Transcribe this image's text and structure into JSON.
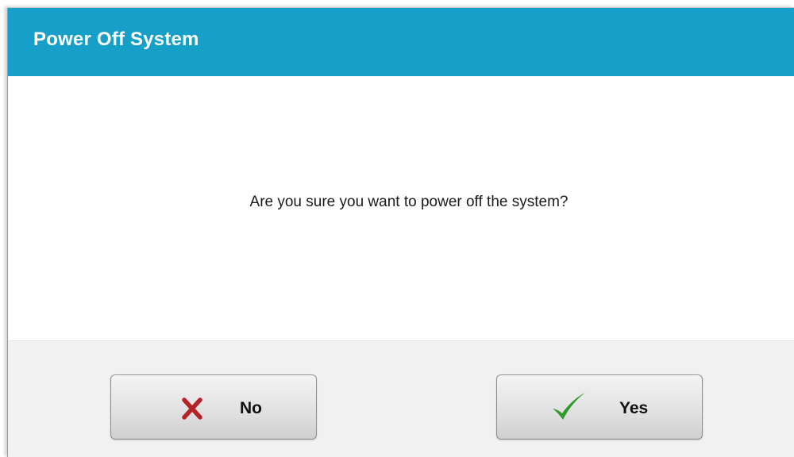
{
  "dialog": {
    "title": "Power Off System",
    "message": "Are you sure you want to power off the system?",
    "buttons": {
      "no_label": "No",
      "no_icon": "close-x-icon",
      "yes_label": "Yes",
      "yes_icon": "checkmark-icon"
    }
  },
  "colors": {
    "title_bar": "#169fc9",
    "no_icon": "#b42327",
    "yes_icon": "#2e9c2a"
  }
}
